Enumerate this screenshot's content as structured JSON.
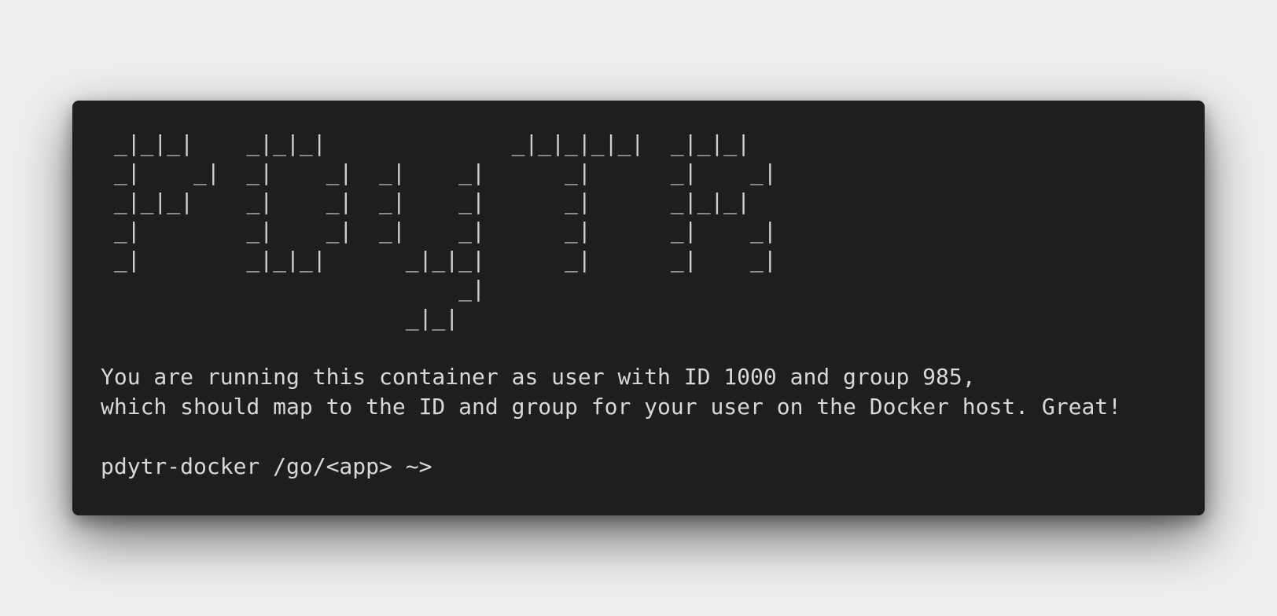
{
  "terminal": {
    "banner": " _|_|_|    _|_|_|              _|_|_|_|_|  _|_|_|\n _|    _|  _|    _|  _|    _|      _|      _|    _|\n _|_|_|    _|    _|  _|    _|      _|      _|_|_|\n _|        _|    _|  _|    _|      _|      _|    _|\n _|        _|_|_|      _|_|_|      _|      _|    _|\n                           _|\n                       _|_|",
    "message_line_1": "You are running this container as user with ID 1000 and group 985,",
    "message_line_2": "which should map to the ID and group for your user on the Docker host. Great!",
    "prompt": "pdytr-docker /go/<app> ~> ",
    "input_value": ""
  }
}
